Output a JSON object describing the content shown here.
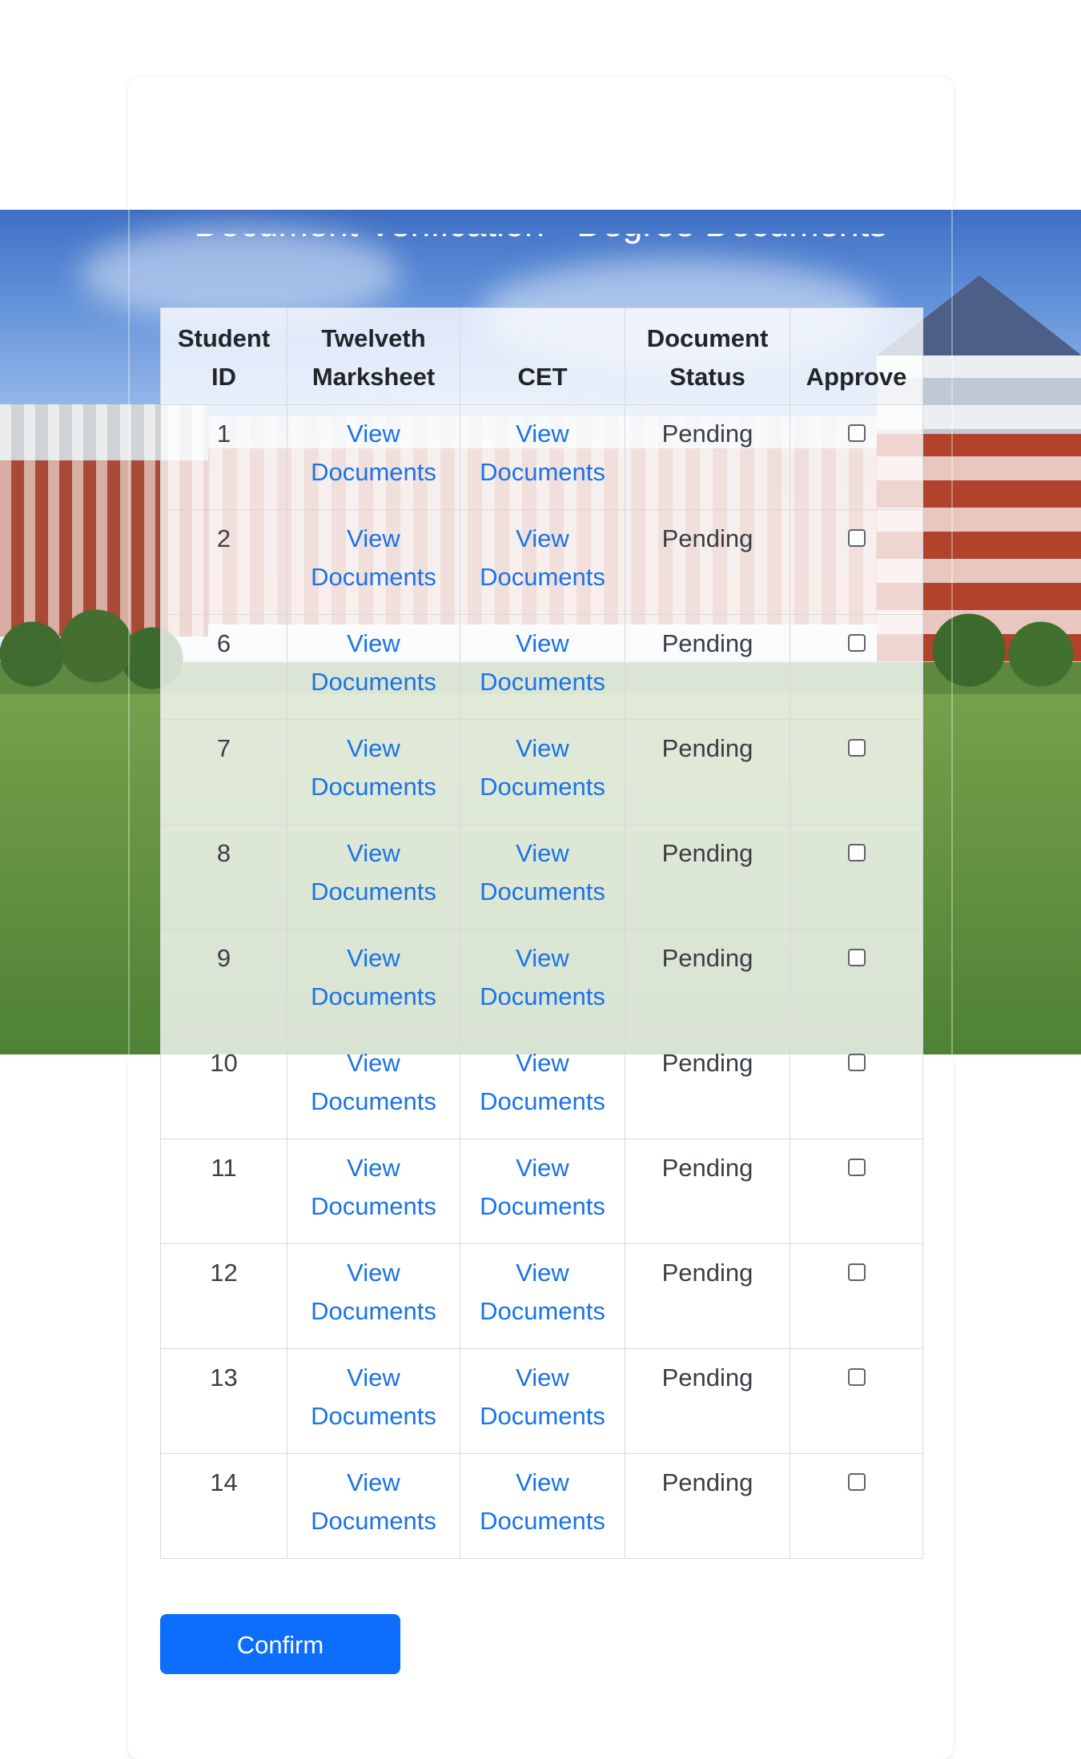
{
  "page": {
    "title": "Document Verification - Degree Documents"
  },
  "table": {
    "headers": {
      "student_id": "Student ID",
      "twelveth": "Twelveth Marksheet",
      "cet": "CET",
      "status": "Document Status",
      "approve": "Approve"
    },
    "rows": [
      {
        "student_id": "1",
        "twelveth_link": "View Documents",
        "cet_link": "View Documents",
        "status": "Pending",
        "approved": false
      },
      {
        "student_id": "2",
        "twelveth_link": "View Documents",
        "cet_link": "View Documents",
        "status": "Pending",
        "approved": false
      },
      {
        "student_id": "6",
        "twelveth_link": "View Documents",
        "cet_link": "View Documents",
        "status": "Pending",
        "approved": false
      },
      {
        "student_id": "7",
        "twelveth_link": "View Documents",
        "cet_link": "View Documents",
        "status": "Pending",
        "approved": false
      },
      {
        "student_id": "8",
        "twelveth_link": "View Documents",
        "cet_link": "View Documents",
        "status": "Pending",
        "approved": false
      },
      {
        "student_id": "9",
        "twelveth_link": "View Documents",
        "cet_link": "View Documents",
        "status": "Pending",
        "approved": false
      },
      {
        "student_id": "10",
        "twelveth_link": "View Documents",
        "cet_link": "View Documents",
        "status": "Pending",
        "approved": false
      },
      {
        "student_id": "11",
        "twelveth_link": "View Documents",
        "cet_link": "View Documents",
        "status": "Pending",
        "approved": false
      },
      {
        "student_id": "12",
        "twelveth_link": "View Documents",
        "cet_link": "View Documents",
        "status": "Pending",
        "approved": false
      },
      {
        "student_id": "13",
        "twelveth_link": "View Documents",
        "cet_link": "View Documents",
        "status": "Pending",
        "approved": false
      },
      {
        "student_id": "14",
        "twelveth_link": "View Documents",
        "cet_link": "View Documents",
        "status": "Pending",
        "approved": false
      }
    ]
  },
  "actions": {
    "confirm_label": "Confirm"
  },
  "colors": {
    "link": "#1a73e8",
    "primary_button": "#0d6efd",
    "title_text": "#ffffff"
  }
}
